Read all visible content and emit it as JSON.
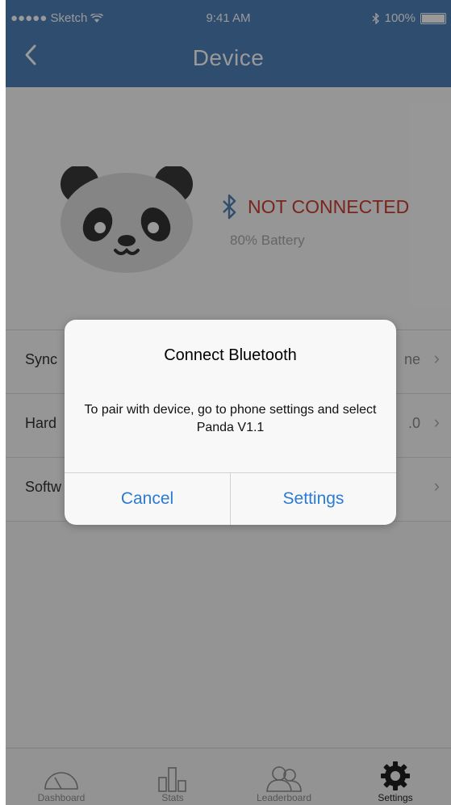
{
  "status_bar": {
    "carrier": "●●●●● Sketch",
    "time": "9:41 AM",
    "battery": "100%"
  },
  "nav": {
    "title": "Device",
    "back_icon": "chevron-left-icon"
  },
  "device": {
    "connection_status": "NOT CONNECTED",
    "battery": "80% Battery"
  },
  "rows": [
    {
      "label": "Sync",
      "value": "ne"
    },
    {
      "label": "Hard",
      "value": ".0"
    },
    {
      "label": "Softw",
      "value": ""
    }
  ],
  "alert": {
    "title": "Connect Bluetooth",
    "message": "To pair with device, go to phone settings and select Panda V1.1",
    "cancel_label": "Cancel",
    "settings_label": "Settings"
  },
  "tabs": [
    {
      "label": "Dashboard",
      "icon": "gauge-icon"
    },
    {
      "label": "Stats",
      "icon": "bar-chart-icon"
    },
    {
      "label": "Leaderboard",
      "icon": "users-icon"
    },
    {
      "label": "Settings",
      "icon": "gear-icon"
    }
  ],
  "colors": {
    "header": "#4f80b9",
    "error": "#cc3d30",
    "link": "#2b7bd4"
  }
}
